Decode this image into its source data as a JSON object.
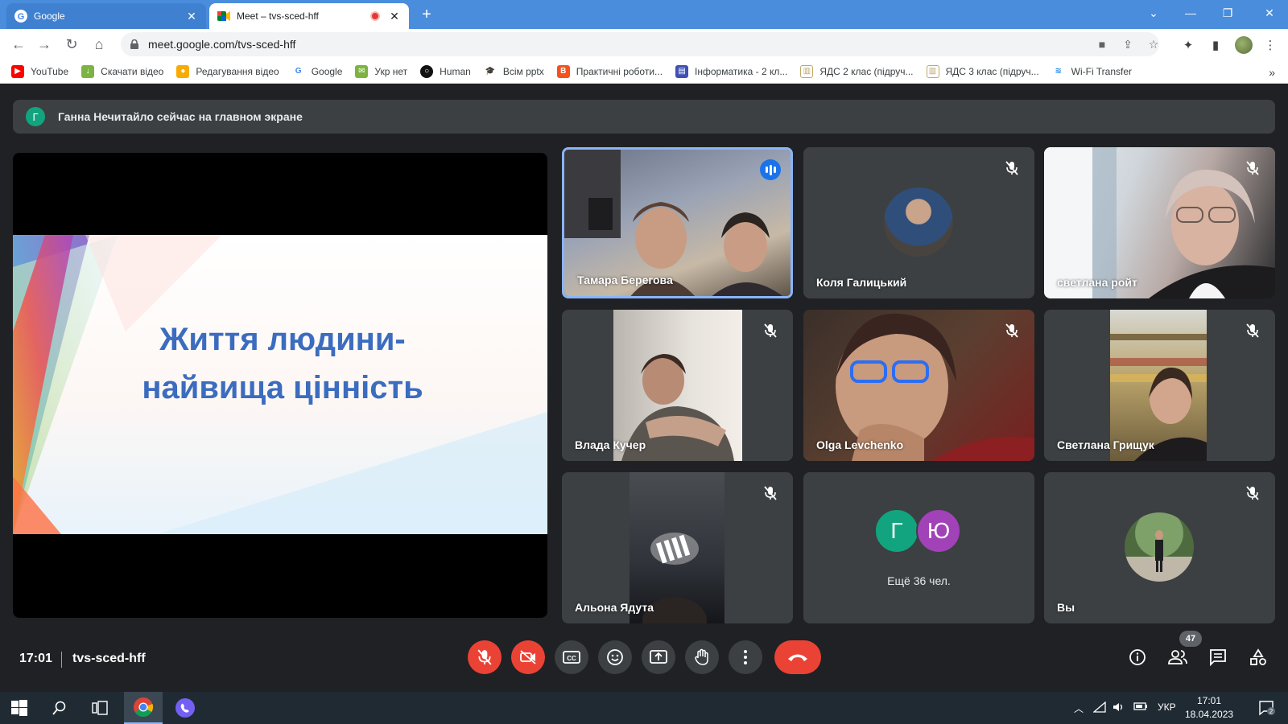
{
  "browser": {
    "tabs": [
      {
        "title": "Google",
        "active": false
      },
      {
        "title": "Meet – tvs-sced-hff",
        "active": true
      }
    ],
    "url": "meet.google.com/tvs-sced-hff",
    "bookmarks": [
      {
        "label": "YouTube",
        "color": "#ff0000"
      },
      {
        "label": "Скачати відео",
        "color": "#7cb342"
      },
      {
        "label": "Редагування відео",
        "color": "#f9ab00"
      },
      {
        "label": "Google",
        "color": "#4285f4"
      },
      {
        "label": "Укр нет",
        "color": "#7cb342"
      },
      {
        "label": "Human",
        "color": "#111111"
      },
      {
        "label": "Всім pptx",
        "color": "#333333"
      },
      {
        "label": "Практичні роботи...",
        "color": "#f4511e"
      },
      {
        "label": "Інформатика - 2 кл...",
        "color": "#3f51b5"
      },
      {
        "label": "ЯДС 2 клас (підруч...",
        "color": "#bfa76a"
      },
      {
        "label": "ЯДС 3 клас (підруч...",
        "color": "#bfa76a"
      },
      {
        "label": "Wi-Fi Transfer",
        "color": "#1e88e5"
      }
    ],
    "more_bookmarks": "»"
  },
  "meet": {
    "banner": {
      "avatar_letter": "Г",
      "text": "Ганна Нечитайло сейчас на главном экране"
    },
    "slide_title_line1": "Життя людини-",
    "slide_title_line2": "найвища цінність",
    "participants": [
      {
        "name": "Тамара Берегова",
        "speaking": true
      },
      {
        "name": "Коля Галицький",
        "muted": true
      },
      {
        "name": "светлана ройт",
        "muted": true
      },
      {
        "name": "Влада Кучер",
        "muted": true
      },
      {
        "name": "Olga Levchenko",
        "muted": true
      },
      {
        "name": "Светлана Грищук",
        "muted": true
      },
      {
        "name": "Альона Ядута",
        "muted": true
      },
      {
        "name": "Вы",
        "muted": true
      }
    ],
    "more": {
      "avatar1": "Г",
      "avatar1_color": "#12a47e",
      "avatar2": "Ю",
      "avatar2_color": "#a142b8",
      "text": "Ещё 36 чел."
    },
    "time": "17:01",
    "code": "tvs-sced-hff",
    "participant_count": "47"
  },
  "taskbar": {
    "lang": "УКР",
    "time": "17:01",
    "date": "18.04.2023",
    "notifications": "2"
  }
}
